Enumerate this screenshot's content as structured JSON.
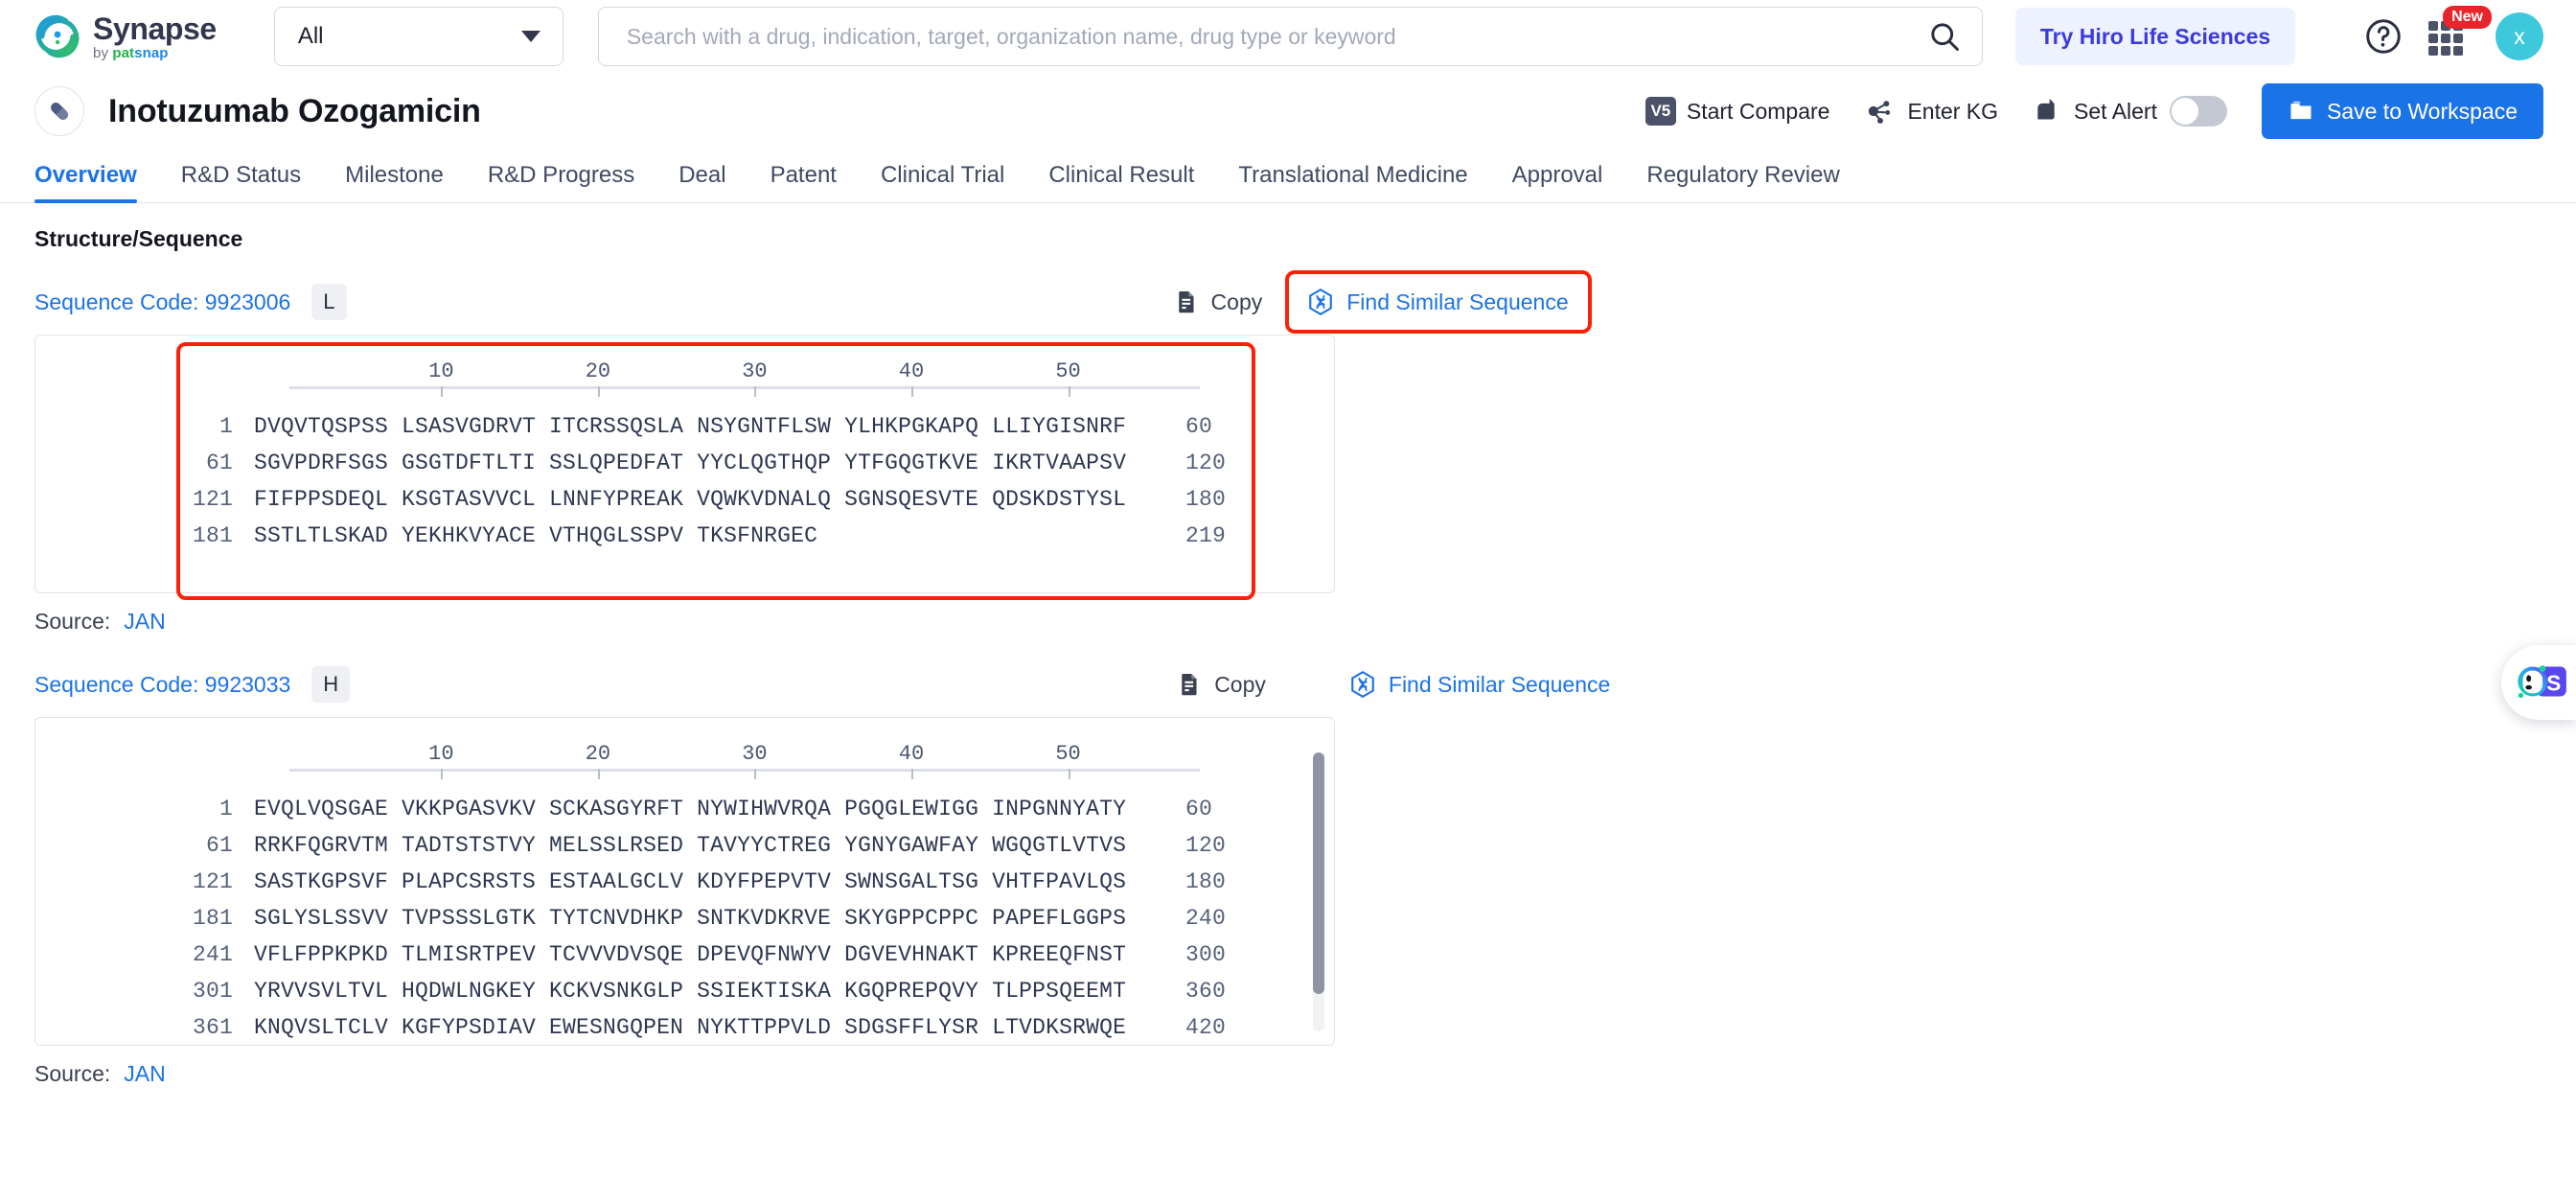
{
  "header": {
    "logo": {
      "title": "Synapse",
      "by": "by ",
      "pat": "pat",
      "snap": "snap"
    },
    "scope": {
      "value": "All",
      "icon": "chevron-down-icon"
    },
    "search": {
      "value": "",
      "placeholder": "Search with a drug, indication, target, organization name, drug type or keyword",
      "icon": "search-icon"
    },
    "promo_button": "Try Hiro Life Sciences",
    "help_icon": "question-mark-circle-icon",
    "apps_icon": "grid-apps-icon",
    "apps_badge": "New",
    "avatar_initial": "x"
  },
  "drug": {
    "icon": "capsule-pill-icon",
    "title": "Inotuzumab Ozogamicin",
    "actions": {
      "compare": {
        "badge": "V5",
        "label": "Start Compare"
      },
      "enter_kg": {
        "icon": "knowledge-graph-icon",
        "label": "Enter KG"
      },
      "set_alert": {
        "icon": "bell-alert-icon",
        "label": "Set Alert",
        "toggle_on": false
      },
      "save": {
        "icon": "folder-icon",
        "label": "Save to Workspace"
      }
    }
  },
  "tabs": [
    {
      "label": "Overview",
      "active": true
    },
    {
      "label": "R&D Status",
      "active": false
    },
    {
      "label": "Milestone",
      "active": false
    },
    {
      "label": "R&D Progress",
      "active": false
    },
    {
      "label": "Deal",
      "active": false
    },
    {
      "label": "Patent",
      "active": false
    },
    {
      "label": "Clinical Trial",
      "active": false
    },
    {
      "label": "Clinical Result",
      "active": false
    },
    {
      "label": "Translational Medicine",
      "active": false
    },
    {
      "label": "Approval",
      "active": false
    },
    {
      "label": "Regulatory Review",
      "active": false
    }
  ],
  "section": {
    "title": "Structure/Sequence"
  },
  "common": {
    "copy_label": "Copy",
    "copy_icon": "copy-icon",
    "find_label": "Find Similar Sequence",
    "find_icon": "dna-hexagon-icon",
    "source_label": "Source:",
    "source_value": "JAN",
    "ruler_ticks": [
      "10",
      "20",
      "30",
      "40",
      "50"
    ]
  },
  "sequences": [
    {
      "code_label": "Sequence Code: 9923006",
      "chain": "L",
      "highlighted_find": true,
      "rows": [
        {
          "start": "1",
          "body": "DVQVTQSPSS LSASVGDRVT ITCRSSQSLA NSYGNTFLSW YLHKPGKAPQ LLIYGISNRF",
          "end": "60"
        },
        {
          "start": "61",
          "body": "SGVPDRFSGS GSGTDFTLTI SSLQPEDFAT YYCLQGTHQP YTFGQGTKVE IKRTVAAPSV",
          "end": "120"
        },
        {
          "start": "121",
          "body": "FIFPPSDEQL KSGTASVVCL LNNFYPREAK VQWKVDNALQ SGNSQESVTE QDSKDSTYSL",
          "end": "180"
        },
        {
          "start": "181",
          "body": "SSTLTLSKAD YEKHKVYACE VTHQGLSSPV TKSFNRGEC",
          "end": "219"
        }
      ]
    },
    {
      "code_label": "Sequence Code: 9923033",
      "chain": "H",
      "highlighted_find": false,
      "scrollable": true,
      "rows": [
        {
          "start": "1",
          "body": "EVQLVQSGAE VKKPGASVKV SCKASGYRFT NYWIHWVRQA PGQGLEWIGG INPGNNYATY",
          "end": "60"
        },
        {
          "start": "61",
          "body": "RRKFQGRVTM TADTSTSTVY MELSSLRSED TAVYYCTREG YGNYGAWFAY WGQGTLVTVS",
          "end": "120"
        },
        {
          "start": "121",
          "body": "SASTKGPSVF PLAPCSRSTS ESTAALGCLV KDYFPEPVTV SWNSGALTSG VHTFPAVLQS",
          "end": "180"
        },
        {
          "start": "181",
          "body": "SGLYSLSSVV TVPSSSLGTK TYTCNVDHKP SNTKVDKRVE SKYGPPCPPC PAPEFLGGPS",
          "end": "240"
        },
        {
          "start": "241",
          "body": "VFLFPPKPKD TLMISRTPEV TCVVVDVSQE DPEVQFNWYV DGVEVHNAKT KPREEQFNST",
          "end": "300"
        },
        {
          "start": "301",
          "body": "YRVVSVLTVL HQDWLNGKEY KCKVSNKGLP SSIEKTISKA KGQPREPQVY TLPPSQEEMT",
          "end": "360"
        },
        {
          "start": "361",
          "body": "KNQVSLTCLV KGFYPSDIAV EWESNGQPEN NYKTTPPVLD SDGSFFLYSR LTVDKSRWQE",
          "end": "420"
        }
      ]
    }
  ],
  "assistant": {
    "icon": "ai-assistant-icon"
  },
  "colors": {
    "accent_blue": "#1b73e8",
    "highlight_red": "#fb2108",
    "promo_purple": "#3b3bdb",
    "avatar_teal": "#3dc8db",
    "badge_red": "#e8252b"
  }
}
